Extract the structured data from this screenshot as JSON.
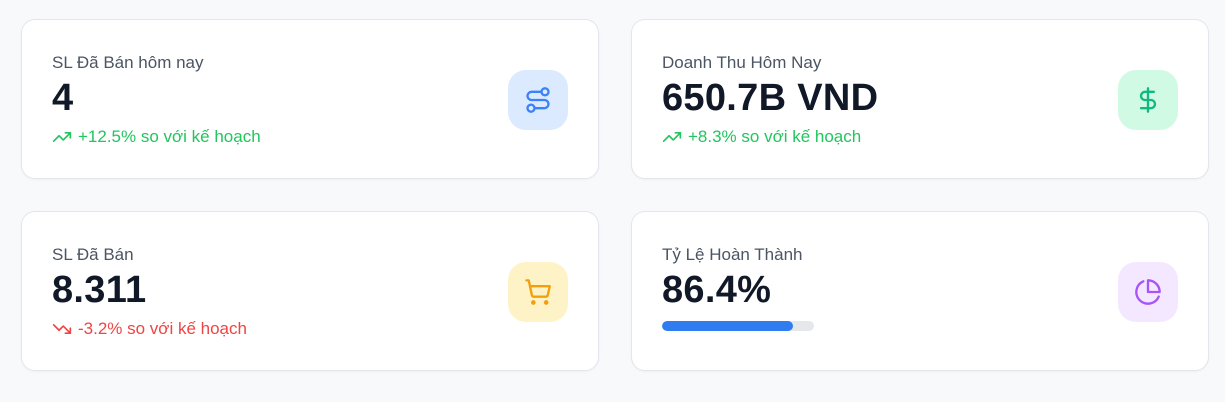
{
  "cards": [
    {
      "label": "SL Đã Bán hôm nay",
      "value": "4",
      "trend": {
        "direction": "up",
        "text": "+12.5% so với kế hoạch",
        "color": "#22c55e"
      },
      "icon": {
        "name": "route-icon",
        "bg": "#dbeafe",
        "color": "#3b82f6"
      }
    },
    {
      "label": "Doanh Thu Hôm Nay",
      "value": "650.7B VND",
      "trend": {
        "direction": "up",
        "text": "+8.3% so với kế hoạch",
        "color": "#22c55e"
      },
      "icon": {
        "name": "dollar-icon",
        "bg": "#d1fae5",
        "color": "#10b981"
      }
    },
    {
      "label": "SL Đã Bán",
      "value": "8.311",
      "trend": {
        "direction": "down",
        "text": "-3.2% so với kế hoạch",
        "color": "#ef4444"
      },
      "icon": {
        "name": "shopping-cart-icon",
        "bg": "#fef3c7",
        "color": "#f59e0b"
      }
    },
    {
      "label": "Tỷ Lệ Hoàn Thành",
      "value": "86.4%",
      "progress": 0.864,
      "icon": {
        "name": "pie-chart-icon",
        "bg": "#f3e8ff",
        "color": "#a855f7"
      }
    }
  ],
  "colors": {
    "progress_fill": "#2f7bf0",
    "progress_track": "#e5e7eb"
  }
}
